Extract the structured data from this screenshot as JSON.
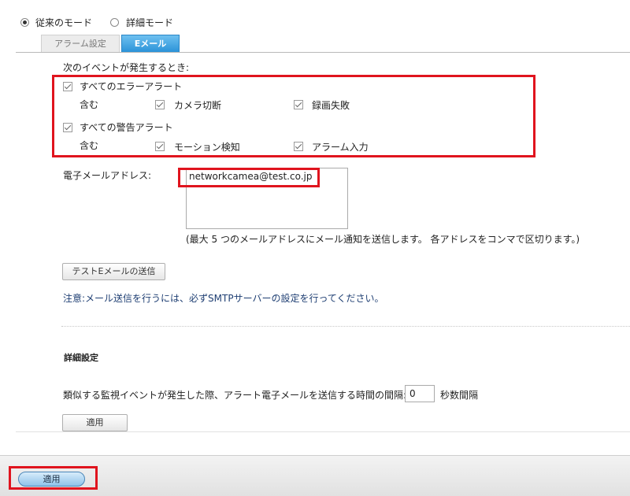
{
  "mode": {
    "legacy_label": "従来のモード",
    "advanced_label": "詳細モード",
    "selected": "legacy"
  },
  "tabs": [
    {
      "label": "アラーム設定",
      "active": false
    },
    {
      "label": "Eメール",
      "active": true
    }
  ],
  "event_section": {
    "heading": "次のイベントが発生するとき:",
    "error_alerts": {
      "label": "すべてのエラーアラート",
      "checked": true,
      "includes_label": "含む",
      "items": [
        {
          "label": "カメラ切断",
          "checked": true
        },
        {
          "label": "録画失敗",
          "checked": true
        }
      ]
    },
    "warning_alerts": {
      "label": "すべての警告アラート",
      "checked": true,
      "includes_label": "含む",
      "items": [
        {
          "label": "モーション検知",
          "checked": true
        },
        {
          "label": "アラーム入力",
          "checked": true
        }
      ]
    }
  },
  "email": {
    "label": "電子メールアドレス:",
    "value": "networkcamea@test.co.jp",
    "hint": "(最大 5 つのメールアドレスにメール通知を送信します。 各アドレスをコンマで区切ります。)"
  },
  "test_button_label": "テストEメールの送信",
  "note": "注意:メール送信を行うには、必ずSMTPサーバーの設定を行ってください。",
  "advanced": {
    "heading": "詳細設定",
    "interval_label": "類似する監視イベントが発生した際、アラート電子メールを送信する時間の間隔:",
    "interval_value": "0",
    "interval_unit": "秒数間隔",
    "apply_label": "適用"
  },
  "footer": {
    "apply_label": "適用"
  },
  "colors": {
    "highlight": "#e0141e",
    "note_text": "#1f3f73",
    "tab_active": "#2b93d8"
  }
}
